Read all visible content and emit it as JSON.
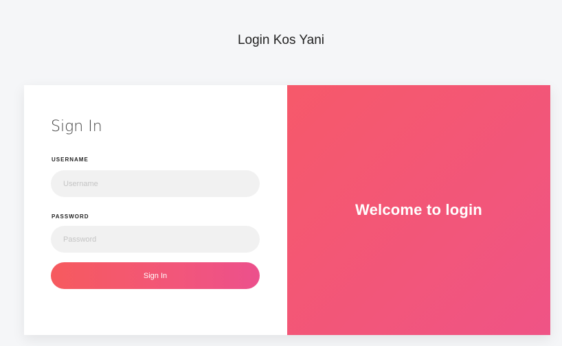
{
  "page": {
    "title": "Login Kos Yani"
  },
  "form": {
    "heading": "Sign In",
    "username_label": "USERNAME",
    "username_placeholder": "Username",
    "password_label": "PASSWORD",
    "password_placeholder": "Password",
    "submit_label": "Sign In"
  },
  "welcome": {
    "text": "Welcome to login"
  },
  "colors": {
    "accent_start": "#f65a5e",
    "accent_end": "#ec508c",
    "input_background": "#f1f1f1",
    "page_background": "#f5f6f8"
  }
}
